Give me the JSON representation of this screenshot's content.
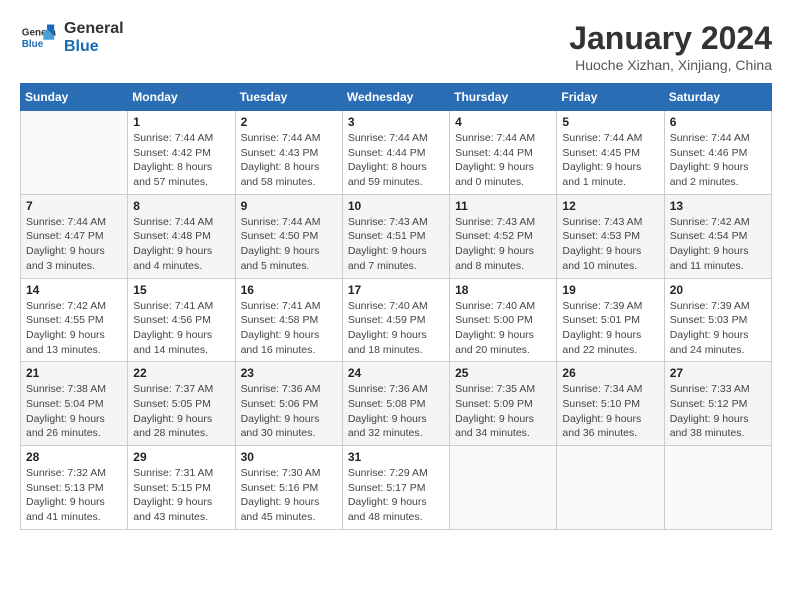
{
  "header": {
    "logo_line1": "General",
    "logo_line2": "Blue",
    "month_title": "January 2024",
    "subtitle": "Huoche Xizhan, Xinjiang, China"
  },
  "weekdays": [
    "Sunday",
    "Monday",
    "Tuesday",
    "Wednesday",
    "Thursday",
    "Friday",
    "Saturday"
  ],
  "weeks": [
    [
      {
        "day": "",
        "info": ""
      },
      {
        "day": "1",
        "info": "Sunrise: 7:44 AM\nSunset: 4:42 PM\nDaylight: 8 hours\nand 57 minutes."
      },
      {
        "day": "2",
        "info": "Sunrise: 7:44 AM\nSunset: 4:43 PM\nDaylight: 8 hours\nand 58 minutes."
      },
      {
        "day": "3",
        "info": "Sunrise: 7:44 AM\nSunset: 4:44 PM\nDaylight: 8 hours\nand 59 minutes."
      },
      {
        "day": "4",
        "info": "Sunrise: 7:44 AM\nSunset: 4:44 PM\nDaylight: 9 hours\nand 0 minutes."
      },
      {
        "day": "5",
        "info": "Sunrise: 7:44 AM\nSunset: 4:45 PM\nDaylight: 9 hours\nand 1 minute."
      },
      {
        "day": "6",
        "info": "Sunrise: 7:44 AM\nSunset: 4:46 PM\nDaylight: 9 hours\nand 2 minutes."
      }
    ],
    [
      {
        "day": "7",
        "info": "Sunrise: 7:44 AM\nSunset: 4:47 PM\nDaylight: 9 hours\nand 3 minutes."
      },
      {
        "day": "8",
        "info": "Sunrise: 7:44 AM\nSunset: 4:48 PM\nDaylight: 9 hours\nand 4 minutes."
      },
      {
        "day": "9",
        "info": "Sunrise: 7:44 AM\nSunset: 4:50 PM\nDaylight: 9 hours\nand 5 minutes."
      },
      {
        "day": "10",
        "info": "Sunrise: 7:43 AM\nSunset: 4:51 PM\nDaylight: 9 hours\nand 7 minutes."
      },
      {
        "day": "11",
        "info": "Sunrise: 7:43 AM\nSunset: 4:52 PM\nDaylight: 9 hours\nand 8 minutes."
      },
      {
        "day": "12",
        "info": "Sunrise: 7:43 AM\nSunset: 4:53 PM\nDaylight: 9 hours\nand 10 minutes."
      },
      {
        "day": "13",
        "info": "Sunrise: 7:42 AM\nSunset: 4:54 PM\nDaylight: 9 hours\nand 11 minutes."
      }
    ],
    [
      {
        "day": "14",
        "info": "Sunrise: 7:42 AM\nSunset: 4:55 PM\nDaylight: 9 hours\nand 13 minutes."
      },
      {
        "day": "15",
        "info": "Sunrise: 7:41 AM\nSunset: 4:56 PM\nDaylight: 9 hours\nand 14 minutes."
      },
      {
        "day": "16",
        "info": "Sunrise: 7:41 AM\nSunset: 4:58 PM\nDaylight: 9 hours\nand 16 minutes."
      },
      {
        "day": "17",
        "info": "Sunrise: 7:40 AM\nSunset: 4:59 PM\nDaylight: 9 hours\nand 18 minutes."
      },
      {
        "day": "18",
        "info": "Sunrise: 7:40 AM\nSunset: 5:00 PM\nDaylight: 9 hours\nand 20 minutes."
      },
      {
        "day": "19",
        "info": "Sunrise: 7:39 AM\nSunset: 5:01 PM\nDaylight: 9 hours\nand 22 minutes."
      },
      {
        "day": "20",
        "info": "Sunrise: 7:39 AM\nSunset: 5:03 PM\nDaylight: 9 hours\nand 24 minutes."
      }
    ],
    [
      {
        "day": "21",
        "info": "Sunrise: 7:38 AM\nSunset: 5:04 PM\nDaylight: 9 hours\nand 26 minutes."
      },
      {
        "day": "22",
        "info": "Sunrise: 7:37 AM\nSunset: 5:05 PM\nDaylight: 9 hours\nand 28 minutes."
      },
      {
        "day": "23",
        "info": "Sunrise: 7:36 AM\nSunset: 5:06 PM\nDaylight: 9 hours\nand 30 minutes."
      },
      {
        "day": "24",
        "info": "Sunrise: 7:36 AM\nSunset: 5:08 PM\nDaylight: 9 hours\nand 32 minutes."
      },
      {
        "day": "25",
        "info": "Sunrise: 7:35 AM\nSunset: 5:09 PM\nDaylight: 9 hours\nand 34 minutes."
      },
      {
        "day": "26",
        "info": "Sunrise: 7:34 AM\nSunset: 5:10 PM\nDaylight: 9 hours\nand 36 minutes."
      },
      {
        "day": "27",
        "info": "Sunrise: 7:33 AM\nSunset: 5:12 PM\nDaylight: 9 hours\nand 38 minutes."
      }
    ],
    [
      {
        "day": "28",
        "info": "Sunrise: 7:32 AM\nSunset: 5:13 PM\nDaylight: 9 hours\nand 41 minutes."
      },
      {
        "day": "29",
        "info": "Sunrise: 7:31 AM\nSunset: 5:15 PM\nDaylight: 9 hours\nand 43 minutes."
      },
      {
        "day": "30",
        "info": "Sunrise: 7:30 AM\nSunset: 5:16 PM\nDaylight: 9 hours\nand 45 minutes."
      },
      {
        "day": "31",
        "info": "Sunrise: 7:29 AM\nSunset: 5:17 PM\nDaylight: 9 hours\nand 48 minutes."
      },
      {
        "day": "",
        "info": ""
      },
      {
        "day": "",
        "info": ""
      },
      {
        "day": "",
        "info": ""
      }
    ]
  ]
}
